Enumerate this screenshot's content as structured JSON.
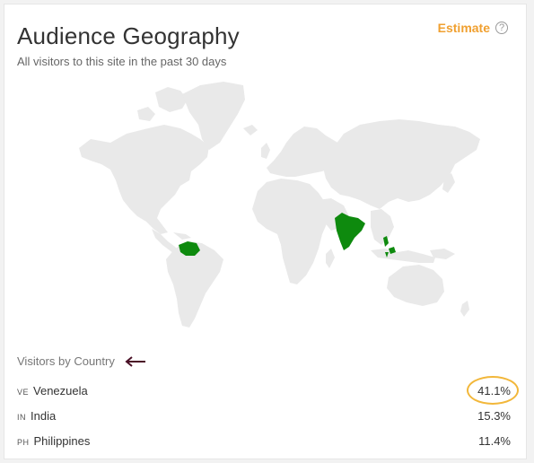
{
  "header": {
    "title": "Audience Geography",
    "subtitle": "All visitors to this site in the past 30 days",
    "estimate_label": "Estimate",
    "help_glyph": "?"
  },
  "map": {
    "land_color": "#e9e9e9",
    "highlight_color": "#0e8a0e",
    "highlighted_countries": [
      "Venezuela",
      "India",
      "Philippines"
    ]
  },
  "visitors": {
    "section_label": "Visitors by Country",
    "annotation_icon": "arrow-left-icon",
    "rows": [
      {
        "code": "VE",
        "country": "Venezuela",
        "percent": "41.1%"
      },
      {
        "code": "IN",
        "country": "India",
        "percent": "15.3%"
      },
      {
        "code": "PH",
        "country": "Philippines",
        "percent": "11.4%"
      }
    ]
  },
  "colors": {
    "accent": "#f0a030",
    "annotation_ring": "#f2b73a",
    "annotation_arrow": "#4a1026"
  }
}
